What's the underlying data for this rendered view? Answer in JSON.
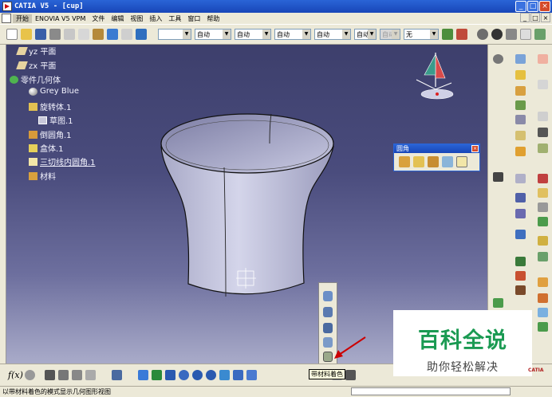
{
  "window": {
    "title": "CATIA V5 - [cup]",
    "controls": [
      "_",
      "□",
      "×"
    ],
    "mdi_controls": [
      "_",
      "□",
      "×"
    ]
  },
  "menu": [
    "开始",
    "ENOVIA V5 VPM",
    "文件",
    "编辑",
    "视图",
    "插入",
    "工具",
    "窗口",
    "帮助"
  ],
  "toolbar": {
    "combos": [
      {
        "value": "",
        "disabled": false
      },
      {
        "value": "自动",
        "disabled": false
      },
      {
        "value": "自动",
        "disabled": false
      },
      {
        "value": "自动",
        "disabled": false
      },
      {
        "value": "自动",
        "disabled": false
      },
      {
        "value": "自动",
        "disabled": false
      },
      {
        "value": "自动",
        "disabled": true
      },
      {
        "value": "无",
        "disabled": false
      }
    ]
  },
  "tree": [
    {
      "label": "yz 平面",
      "icon": "plane-icon"
    },
    {
      "label": "zx 平面",
      "icon": "plane-icon"
    },
    {
      "label": "零件几何体",
      "icon": "body-icon"
    },
    {
      "label": "Grey Blue",
      "icon": "material-sphere-icon"
    },
    {
      "label": "旋转体.1",
      "icon": "shaft-icon"
    },
    {
      "label": "草图.1",
      "icon": "sketch-icon"
    },
    {
      "label": "倒圆角.1",
      "icon": "fillet-icon"
    },
    {
      "label": "盒体.1",
      "icon": "shell-icon"
    },
    {
      "label": "三切线内圆角.1",
      "icon": "tritangent-fillet-icon"
    },
    {
      "label": "材料",
      "icon": "material-icon"
    }
  ],
  "fillet_panel": {
    "title": "圆角",
    "close": "×"
  },
  "bottom_toolbar": {
    "formula": "f(x)"
  },
  "tooltip": "带材料着色",
  "status_text": "以带材料着色的模式显示几何图形视图",
  "watermark": {
    "main": "百科全说",
    "sub": "助你轻松解决"
  },
  "brand": "CATIA",
  "colors": {
    "viewport_top": "#3d3f6c",
    "viewport_bottom": "#a9abc9",
    "titlebar": "#2a64d6",
    "watermark_green": "#1a9a52"
  }
}
